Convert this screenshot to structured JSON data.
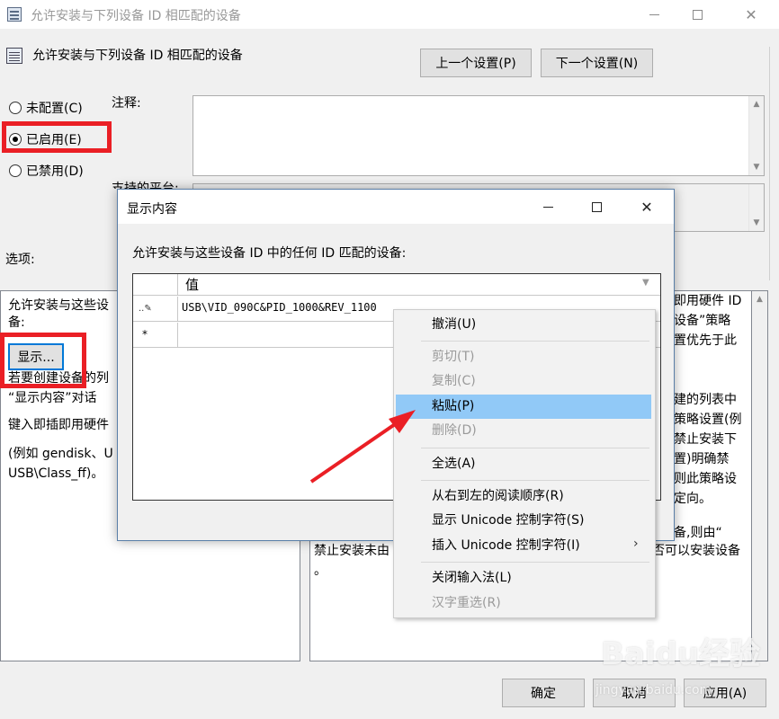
{
  "outer": {
    "title": "允许安装与下列设备 ID 相匹配的设备",
    "header_title": "允许安装与下列设备 ID 相匹配的设备",
    "prev_button": "上一个设置(P)",
    "next_button": "下一个设置(N)",
    "radios": [
      {
        "label": "未配置(C)",
        "checked": false
      },
      {
        "label": "已启用(E)",
        "checked": true
      },
      {
        "label": "已禁用(D)",
        "checked": false
      }
    ],
    "comment_label": "注释:",
    "platform_label": "支持的平台:",
    "options_label": "选项:",
    "left_panel": {
      "line1": "允许安装与这些设",
      "line2": "备:",
      "show_button": "显示...",
      "line3": "若要创建设备的列",
      "line4": "“显示内容”对话",
      "line5": "键入即插即用硬件",
      "line6": "(例如 gendisk、U",
      "line7": "USB\\Class_ff)。"
    },
    "right_panel": {
      "line1": "即用硬件 ID",
      "line2": "设备”策略",
      "line3": "置优先于此",
      "line4": "建的列表中",
      "line5": "策略设置(例",
      "line6": "禁止安装下",
      "line7": "置)明确禁",
      "line8": "则此策略设",
      "line9": "定向。",
      "line10": "备,则由“",
      "line11": "禁止安装未由",
      "line12": "否可以安装设备",
      "line13": "。"
    },
    "ok_button": "确定",
    "cancel_button": "取消",
    "apply_button": "应用(A)"
  },
  "dialog": {
    "title": "显示内容",
    "label": "允许安装与这些设备 ID 中的任何 ID 匹配的设备:",
    "column_header": "值",
    "rows": [
      "USB\\VID_090C&PID_1000&REV_1100",
      ""
    ]
  },
  "context_menu": {
    "items": [
      {
        "label": "撤消(U)",
        "disabled": false,
        "highlighted": false
      },
      {
        "label": "剪切(T)",
        "disabled": true,
        "highlighted": false
      },
      {
        "label": "复制(C)",
        "disabled": true,
        "highlighted": false
      },
      {
        "label": "粘贴(P)",
        "disabled": false,
        "highlighted": true
      },
      {
        "label": "删除(D)",
        "disabled": true,
        "highlighted": false
      },
      {
        "label": "全选(A)",
        "disabled": false,
        "highlighted": false
      },
      {
        "label": "从右到左的阅读顺序(R)",
        "disabled": false,
        "highlighted": false
      },
      {
        "label": "显示 Unicode 控制字符(S)",
        "disabled": false,
        "highlighted": false
      },
      {
        "label": "插入 Unicode 控制字符(I)",
        "disabled": false,
        "highlighted": false
      },
      {
        "label": "关闭输入法(L)",
        "disabled": false,
        "highlighted": false
      },
      {
        "label": "汉字重选(R)",
        "disabled": true,
        "highlighted": false
      }
    ]
  },
  "watermark": {
    "text": "Baidu经验",
    "subtext": "jingyan.baidu.com"
  },
  "colors": {
    "highlight_box": "#ea1f25",
    "arrow": "#ea1f25",
    "menu_highlight": "#91c9f7"
  }
}
